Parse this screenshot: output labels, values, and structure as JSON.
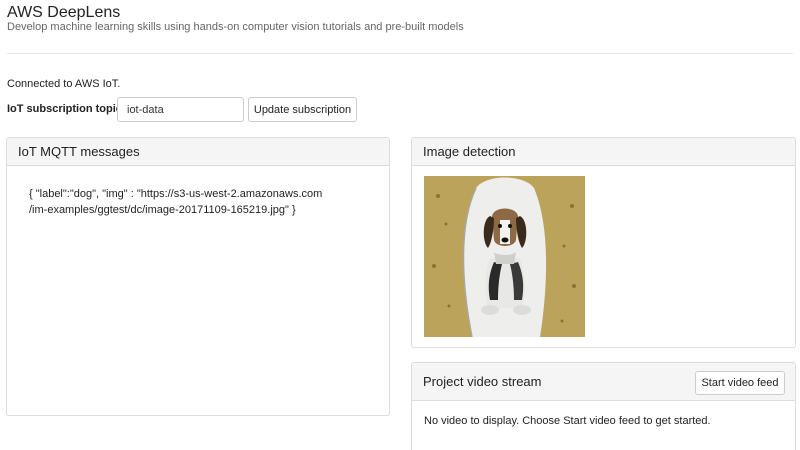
{
  "header": {
    "title": "AWS DeepLens",
    "subtitle": "Develop machine learning skills using hands-on computer vision tutorials and pre-built models"
  },
  "status": {
    "connection": "Connected to AWS IoT."
  },
  "subscription": {
    "label": "IoT subscription topic:",
    "value": "iot-data",
    "button_label": "Update subscription"
  },
  "panels": {
    "mqtt": {
      "title": "IoT MQTT messages",
      "message": "{ \"label\":\"dog\", \"img\" : \"https://s3-us-west-2.amazonaws.com\n/im-examples/ggtest/dc/image-20171109-165219.jpg\" }"
    },
    "detection": {
      "title": "Image detection"
    },
    "video": {
      "title": "Project video stream",
      "button_label": "Start video feed",
      "empty_message": "No video to display. Choose Start video feed to get started."
    }
  }
}
